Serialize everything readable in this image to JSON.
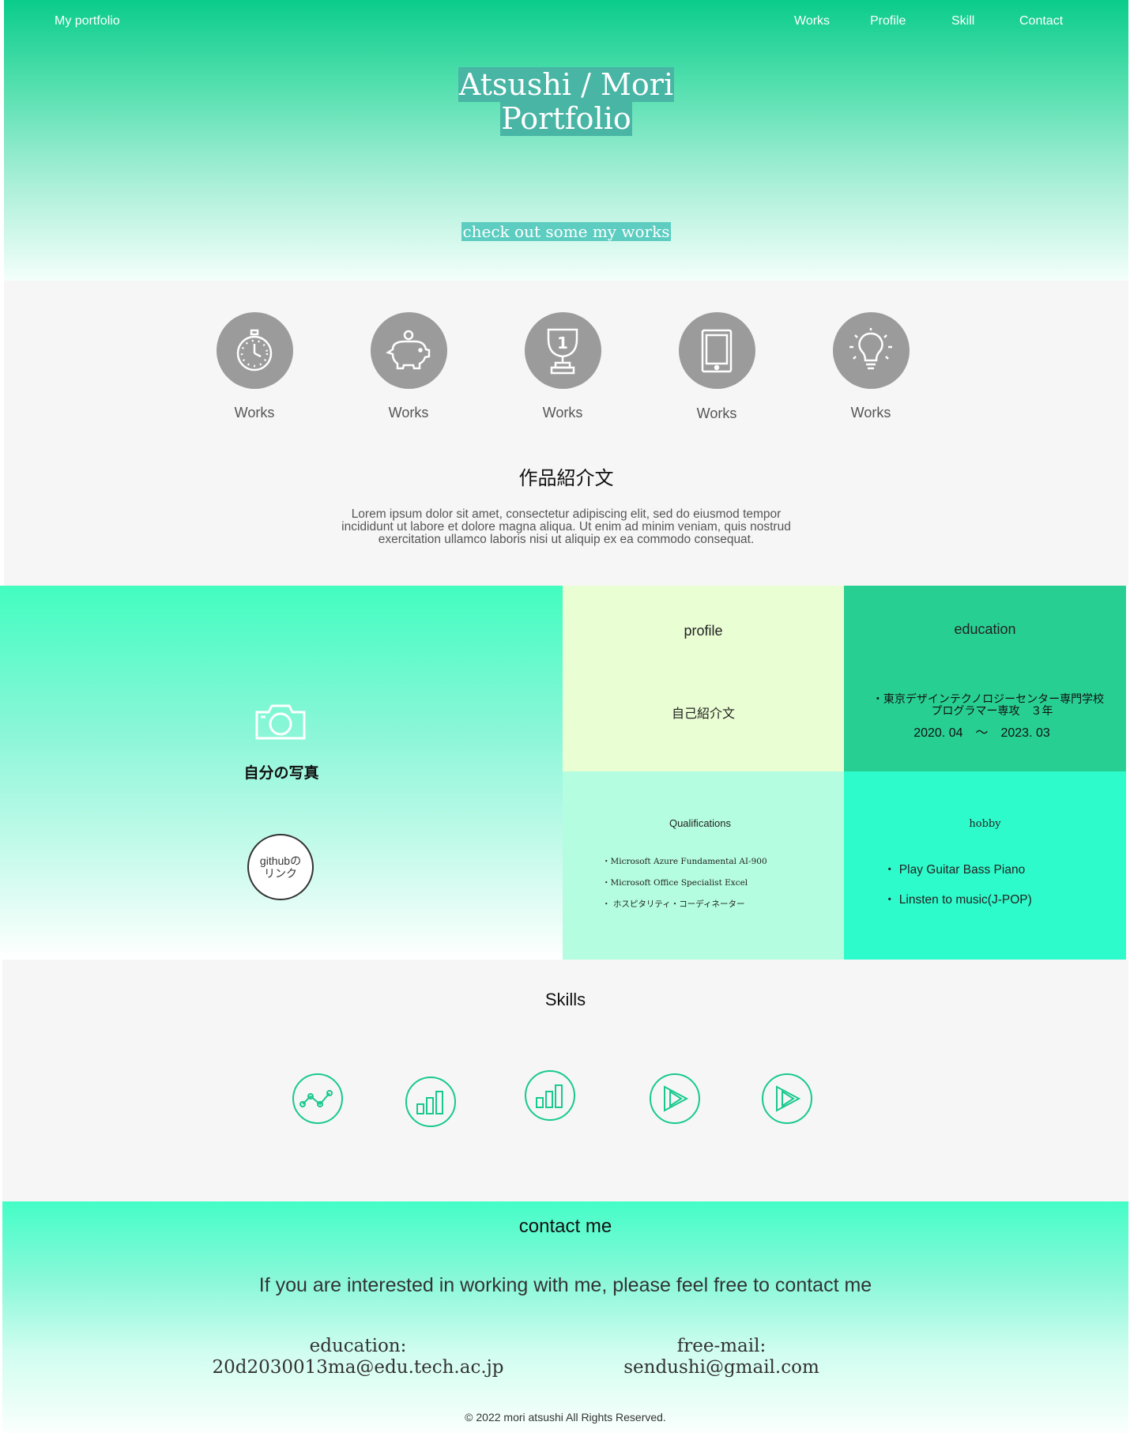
{
  "header": {
    "brand": "My portfolio",
    "nav": [
      "Works",
      "Profile",
      "Skill",
      "Contact"
    ]
  },
  "hero": {
    "title_line1": "Atsushi / Mori",
    "title_line2": "Portfolio",
    "subtitle": "check out some my works"
  },
  "works": {
    "items": [
      {
        "icon": "stopwatch-icon",
        "label": "Works"
      },
      {
        "icon": "piggy-bank-icon",
        "label": "Works"
      },
      {
        "icon": "trophy-icon",
        "label": "Works"
      },
      {
        "icon": "tablet-icon",
        "label": "Works"
      },
      {
        "icon": "lightbulb-icon",
        "label": "Works"
      }
    ],
    "heading": "作品紹介文",
    "description_lines": [
      "Lorem ipsum dolor sit amet, consectetur adipiscing elit, sed do eiusmod tempor",
      "incididunt ut labore et dolore magna aliqua. Ut enim ad minim veniam, quis nostrud",
      "exercitation ullamco laboris nisi ut aliquip ex ea commodo consequat."
    ]
  },
  "profile": {
    "photo_label": "自分の写真",
    "github_line1": "githubの",
    "github_line2": "リンク",
    "profile_title": "profile",
    "profile_text": "自己紹介文",
    "education_title": "education",
    "education_school": "・東京デザインテクノロジーセンター専門学校",
    "education_course": "プログラマー専攻　３年",
    "education_period": "2020. 04　～　2023. 03",
    "qualifications_title": "Qualifications",
    "qualifications": [
      "・Microsoft Azure Fundamental AI-900",
      "・Microsoft Office Specialist Excel",
      "・ ホスピタリティ・コーディネーター"
    ],
    "hobby_title": "hobby",
    "hobbies": [
      "・ Play Guitar Bass Piano",
      "・ Linsten to music(J-POP)"
    ]
  },
  "skills": {
    "title": "Skills",
    "icons": [
      "line-chart-icon",
      "bar-chart-icon",
      "bar-chart-icon",
      "play-icon",
      "play-icon"
    ]
  },
  "contact": {
    "title": "contact me",
    "lead": "If you are interested in working with me, please feel free to contact me",
    "education_label": "education:",
    "education_email": "20d2030013ma@edu.tech.ac.jp",
    "free_label": "free-mail:",
    "free_email": "sendushi@gmail.com",
    "copyright": "© 2022 mori atsushi All Rights Reserved."
  },
  "colors": {
    "accent": "#0acc8b",
    "skill_icon": "#18c98c",
    "work_circle": "#9b9b9b"
  }
}
